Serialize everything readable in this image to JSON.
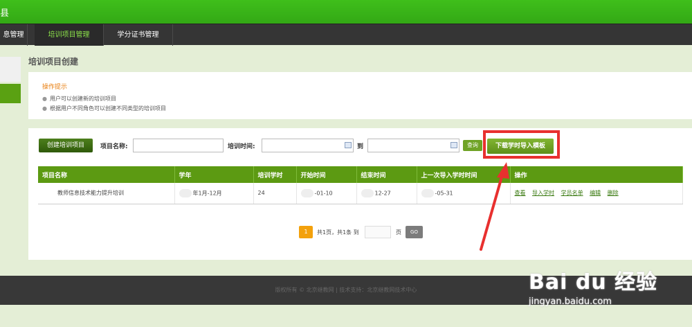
{
  "header": {
    "logo_fragment": "县"
  },
  "nav": {
    "items": [
      {
        "label": "息管理"
      },
      {
        "label": "培训项目管理"
      },
      {
        "label": "学分证书管理"
      }
    ]
  },
  "page": {
    "title": "培训项目创建"
  },
  "tips": {
    "title": "操作提示",
    "lines": [
      "用户可以创建新的培训项目",
      "根据用户不同角色可以创建不同类型的培训项目"
    ]
  },
  "toolbar": {
    "create_label": "创建培训项目",
    "name_label": "项目名称:",
    "time_label": "培训时间:",
    "to_label": "到",
    "query_label": "查询",
    "download_label": "下载学时导入模板"
  },
  "table": {
    "headers": [
      "项目名称",
      "学年",
      "培训学时",
      "开始时间",
      "结束时间",
      "上一次导入学时时间",
      "操作"
    ],
    "rows": [
      {
        "name": "教师信息技术能力提升培训",
        "year": "年1月-12月",
        "hours": "24",
        "start": "-01-10",
        "end": "12-27",
        "last_import": "-05-31",
        "ops": [
          "查看",
          "导入学时",
          "学员名单",
          "编辑",
          "删除"
        ]
      }
    ]
  },
  "pager": {
    "current": "1",
    "summary": "共1页，共1条  到",
    "page_unit": "页",
    "go_label": "GO"
  },
  "footer": {
    "text": "版权所有 © 北京继教网 | 技术支持：北京继教网技术中心"
  },
  "watermark": {
    "main": "Bai du 经验",
    "sub": "jingyan.baidu.com"
  },
  "colors": {
    "highlight": "#e8302f",
    "brand_green": "#5c9a12",
    "accent_orange": "#f3a10c"
  }
}
